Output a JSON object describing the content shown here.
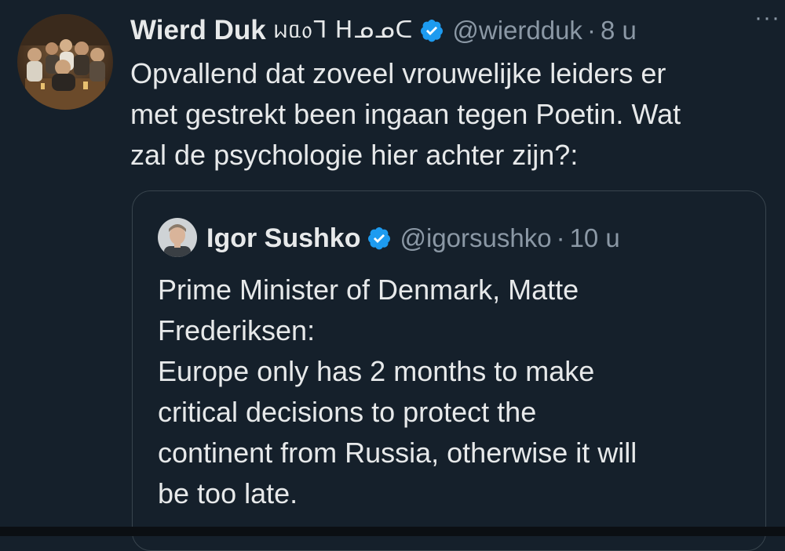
{
  "tweet": {
    "author_name": "Wierd Duk",
    "name_glyphs": "ᥕᥲ᥆ᒣ ᕼᓄᓄᑕ",
    "handle": "@wierdduk",
    "separator": "·",
    "time": "8 u",
    "more_label": "···",
    "text": "Opvallend dat zoveel vrouwelijke leiders er\nmet gestrekt been ingaan tegen Poetin. Wat\nzal de psychologie hier achter zijn?:"
  },
  "quote": {
    "author_name": "Igor Sushko",
    "handle": "@igorsushko",
    "separator": "·",
    "time": "10 u",
    "text": "Prime Minister of Denmark, Matte\nFrederiksen:\nEurope only has 2 months to make\ncritical decisions to protect the\ncontinent from Russia, otherwise it will\nbe too late."
  },
  "colors": {
    "background": "#15202b",
    "text_primary": "#e7e9ea",
    "text_secondary": "#8b98a5",
    "verified_badge": "#1d9bf0",
    "border": "#38444d"
  },
  "icons": {
    "verified": "verified-badge-icon",
    "more": "more-options-icon"
  }
}
